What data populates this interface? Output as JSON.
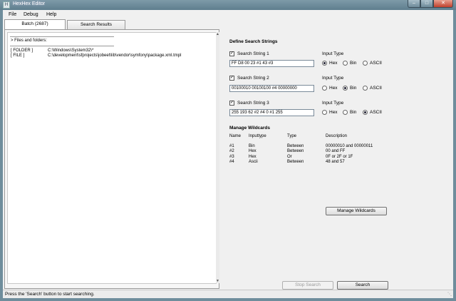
{
  "window": {
    "title": "HexHex Editor",
    "app_icon_glyph": "H"
  },
  "menu": [
    "File",
    "Debug",
    "Help"
  ],
  "tabs": [
    {
      "label": "Batch (2687)",
      "active": true
    },
    {
      "label": "Search Results",
      "active": false
    }
  ],
  "files_panel": {
    "header": "> Files and folders:",
    "entries": [
      {
        "kind": "[ FOLDER ]",
        "path": "C:\\Windows\\System32\\*"
      },
      {
        "kind": "[ FILE ]",
        "path": "C:\\development\\sfprojects\\jobeet\\lib\\vendor\\symfony\\package.xml.tmpl"
      }
    ]
  },
  "search_strings": {
    "title": "Define Search Strings",
    "input_type_label": "Input Type",
    "type_options": [
      "Hex",
      "Bin",
      "ASCII"
    ],
    "items": [
      {
        "label": "Search String 1",
        "checked": true,
        "value": "FF D8 00 23 #1 43 #3",
        "selected_type": "Hex"
      },
      {
        "label": "Search String 2",
        "checked": true,
        "value": "00100010 00100100 #4 00000000",
        "selected_type": "Bin"
      },
      {
        "label": "Search String 3",
        "checked": true,
        "value": "255 193 62 #2 #4 0 #1 255",
        "selected_type": "ASCII"
      }
    ]
  },
  "wildcards": {
    "title": "Manage Wildcards",
    "columns": [
      "Name",
      "Inputtype",
      "Type",
      "Description"
    ],
    "rows": [
      [
        "#1",
        "Bin",
        "Between",
        "00000010 and 00000011"
      ],
      [
        "#2",
        "Hex",
        "Between",
        "00 and FF"
      ],
      [
        "#3",
        "Hex",
        "Or",
        "0F or 2F or 1F"
      ],
      [
        "#4",
        "Ascii",
        "Between",
        "48 and 57"
      ]
    ],
    "manage_button": "Manage Wildcards"
  },
  "buttons": {
    "stop": "Stop Search",
    "search": "Search"
  },
  "status": "Press the 'Search' button to start searching.",
  "colors": {
    "titlebar": "#6f8d9c",
    "close_button": "#c0402c",
    "background": "#f0f0f0"
  }
}
